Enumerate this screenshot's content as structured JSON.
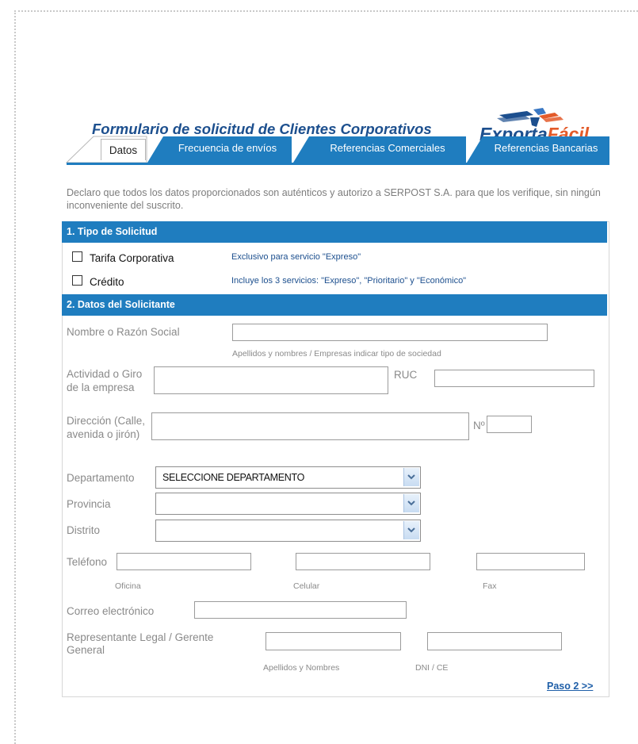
{
  "header": {
    "title": "Formulario de solicitud de Clientes Corporativos",
    "logo_part1": "Exporta",
    "logo_part2": "Fácil"
  },
  "tabs": [
    {
      "label": "Datos",
      "active": true
    },
    {
      "label": "Frecuencia de envíos",
      "active": false
    },
    {
      "label": "Referencias Comerciales",
      "active": false
    },
    {
      "label": "Referencias Bancarias",
      "active": false
    }
  ],
  "intro": "Declaro que todos los datos proporcionados son auténticos y autorizo a SERPOST S.A. para que los verifique, sin ningún inconveniente del suscrito.",
  "section1": {
    "title": "1. Tipo de Solicitud",
    "options": [
      {
        "label": "Tarifa Corporativa",
        "note": "Exclusivo para servicio \"Expreso\"",
        "checked": false
      },
      {
        "label": "Crédito",
        "note": "Incluye los 3 servicios: \"Expreso\", \"Prioritario\" y \"Económico\"",
        "checked": false
      }
    ]
  },
  "section2": {
    "title": "2. Datos del Solicitante",
    "nombre_label": "Nombre o Razón Social",
    "nombre_hint": "Apellidos y nombres / Empresas indicar tipo de sociedad",
    "actividad_label_1": "Actividad o Giro",
    "actividad_label_2": "de la empresa",
    "ruc_label": "RUC",
    "direccion_label_1": "Dirección (Calle,",
    "direccion_label_2": "avenida o jirón)",
    "numero_label": "Nº",
    "departamento_label": "Departamento",
    "departamento_value": "SELECCIONE DEPARTAMENTO",
    "provincia_label": "Provincia",
    "provincia_value": "",
    "distrito_label": "Distrito",
    "distrito_value": "",
    "telefono_label": "Teléfono",
    "oficina_hint": "Oficina",
    "celular_hint": "Celular",
    "fax_hint": "Fax",
    "correo_label": "Correo electrónico",
    "representante_label_1": "Representante Legal / Gerente",
    "representante_label_2": "General",
    "apellidos_hint": "Apellidos y Nombres",
    "dni_hint": "DNI / CE"
  },
  "next_link": "Paso 2 >>",
  "colors": {
    "accent": "#1f7dbf",
    "title": "#1c4f8e",
    "logo_orange": "#e35b2a"
  },
  "icons": {
    "dropdown": "chevron-down-icon",
    "logo": "plane-logo-icon"
  }
}
